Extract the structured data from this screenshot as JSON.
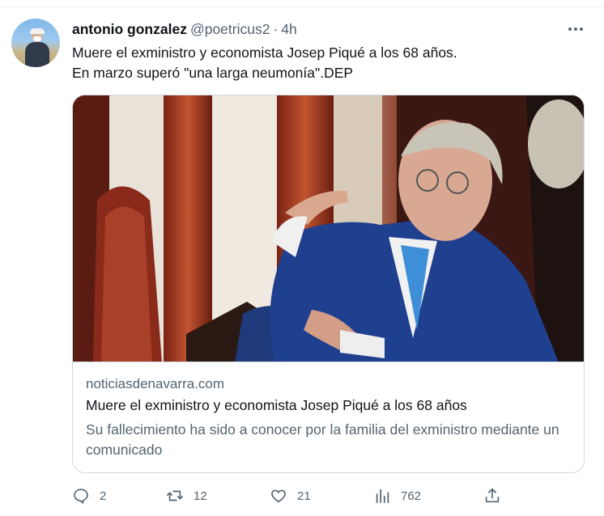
{
  "tweet": {
    "author_name": "antonio gonzalez",
    "handle": "@poetricus2",
    "separator": "·",
    "time": "4h",
    "text_line1": "Muere el exministro y economista Josep Piqué a los 68 años.",
    "text_line2": "En marzo superó \"una larga neumonía\".DEP"
  },
  "card": {
    "domain": "noticiasdenavarra.com",
    "title": "Muere el exministro y economista Josep Piqué a los 68 años",
    "description": "Su fallecimiento ha sido a conocer por la familia del exministro mediante un comunicado"
  },
  "actions": {
    "replies": "2",
    "retweets": "12",
    "likes": "21",
    "views": "762"
  },
  "colors": {
    "text_primary": "#0f1419",
    "text_secondary": "#536471",
    "border": "#cfd9de"
  },
  "icons": [
    "more-icon",
    "reply-icon",
    "retweet-icon",
    "like-icon",
    "views-icon",
    "share-icon"
  ]
}
